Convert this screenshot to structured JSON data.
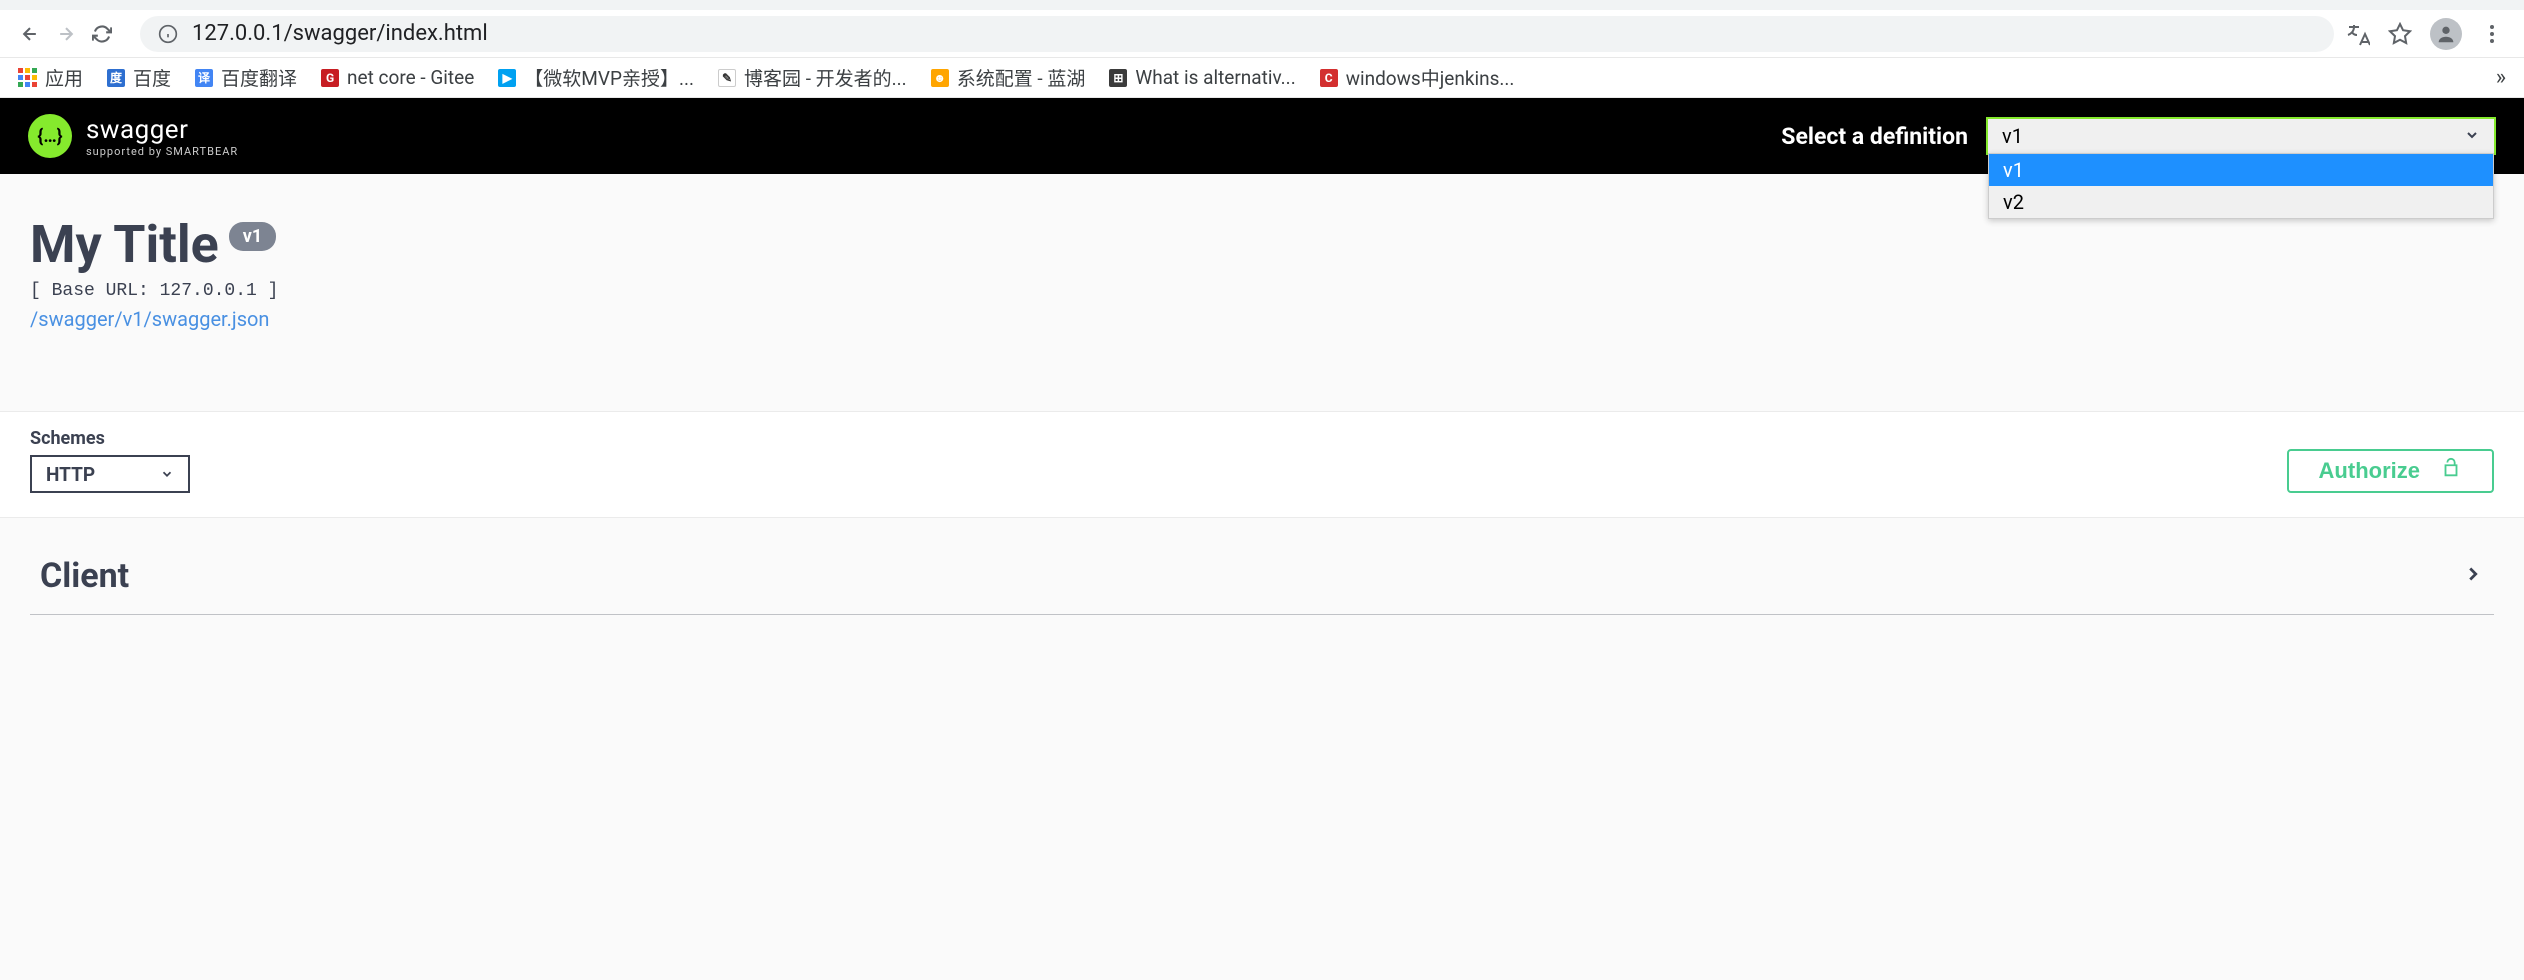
{
  "browser": {
    "url": "127.0.0.1/swagger/index.html"
  },
  "bookmarks": {
    "apps": "应用",
    "items": [
      {
        "label": "百度",
        "icon_bg": "#2e6fd0",
        "icon_txt": "度"
      },
      {
        "label": "百度翻译",
        "icon_bg": "#4285f4",
        "icon_txt": "译"
      },
      {
        "label": "net core - Gitee",
        "icon_bg": "#c71d23",
        "icon_txt": "G"
      },
      {
        "label": "【微软MVP亲授】...",
        "icon_bg": "#00a1f1",
        "icon_txt": "▶"
      },
      {
        "label": "博客园 - 开发者的...",
        "icon_bg": "#fff",
        "icon_txt": "✎"
      },
      {
        "label": "系统配置 - 蓝湖",
        "icon_bg": "#ffa500",
        "icon_txt": "☻"
      },
      {
        "label": "What is alternativ...",
        "icon_bg": "#3b3b3b",
        "icon_txt": "⊞"
      },
      {
        "label": "windows中jenkins...",
        "icon_bg": "#d32f2f",
        "icon_txt": "C"
      }
    ]
  },
  "swagger": {
    "logo_main": "swagger",
    "logo_sub": "supported by SMARTBEAR",
    "def_label": "Select a definition",
    "def_selected": "v1",
    "def_options": [
      "v1",
      "v2"
    ]
  },
  "api": {
    "title": "My Title",
    "version": "v1",
    "base_url": "[ Base URL: 127.0.0.1 ]",
    "json_link": "/swagger/v1/swagger.json"
  },
  "schemes": {
    "label": "Schemes",
    "selected": "HTTP"
  },
  "authorize": {
    "label": "Authorize"
  },
  "tags": [
    {
      "name": "Client"
    }
  ]
}
